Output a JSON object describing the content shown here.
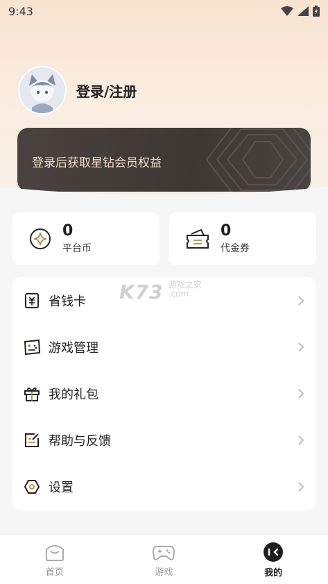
{
  "status_bar": {
    "time": "9:43"
  },
  "profile": {
    "login_label": "登录/注册"
  },
  "vip_card": {
    "text": "登录后获取星钻会员权益"
  },
  "stats": [
    {
      "value": "0",
      "label": "平台币",
      "icon": "coin-icon"
    },
    {
      "value": "0",
      "label": "代金券",
      "icon": "voucher-icon"
    }
  ],
  "menu": {
    "items": [
      {
        "label": "省钱卡",
        "icon": "save-money-card-icon"
      },
      {
        "label": "游戏管理",
        "icon": "game-manage-icon"
      },
      {
        "label": "我的礼包",
        "icon": "gift-icon"
      },
      {
        "label": "帮助与反馈",
        "icon": "feedback-icon"
      },
      {
        "label": "设置",
        "icon": "settings-icon"
      }
    ]
  },
  "watermark": {
    "brand": "K73",
    "line1": "游戏之家",
    "line2": ".com"
  },
  "tabbar": {
    "tabs": [
      {
        "label": "首页",
        "icon": "home-icon"
      },
      {
        "label": "游戏",
        "icon": "gamepad-icon"
      },
      {
        "label": "我的",
        "icon": "profile-icon",
        "active": true
      }
    ]
  },
  "colors": {
    "accent_card": "#3f3936",
    "vip_text": "#f1dcc6",
    "icon_accent": "#b38a4e"
  }
}
